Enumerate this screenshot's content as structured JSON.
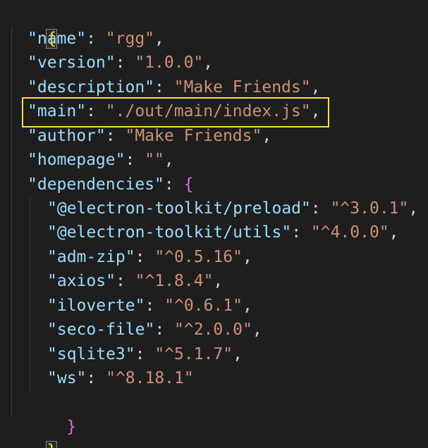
{
  "colors": {
    "background": "#1e1e1e",
    "key": "#9cdcfe",
    "string": "#ce9178",
    "punctuation": "#d4d4d4",
    "outer_brace": "#ffd700",
    "inner_brace": "#da70d6",
    "highlight_box": "#f5e13c"
  },
  "code": {
    "open_brace": "{",
    "close_brace": "}",
    "entries": [
      {
        "key": "\"name\"",
        "value": "\"rgg\"",
        "sep": ": ",
        "trail": ","
      },
      {
        "key": "\"version\"",
        "value": "\"1.0.0\"",
        "sep": ": ",
        "trail": ","
      },
      {
        "key": "\"description\"",
        "value": "\"Make Friends\"",
        "sep": ": ",
        "trail": ","
      },
      {
        "key": "\"main\"",
        "value": "\"./out/main/index.js\"",
        "sep": ": ",
        "trail": ","
      },
      {
        "key": "\"author\"",
        "value": "\"Make Friends\"",
        "sep": ": ",
        "trail": ","
      },
      {
        "key": "\"homepage\"",
        "value": "\"\"",
        "sep": ": ",
        "trail": ","
      }
    ],
    "dependencies": {
      "key": "\"dependencies\"",
      "sep": ": ",
      "open": "{",
      "close": "}",
      "items": [
        {
          "key": "\"@electron-toolkit/preload\"",
          "value": "\"^3.0.1\"",
          "sep": ": ",
          "trail": ","
        },
        {
          "key": "\"@electron-toolkit/utils\"",
          "value": "\"^4.0.0\"",
          "sep": ": ",
          "trail": ","
        },
        {
          "key": "\"adm-zip\"",
          "value": "\"^0.5.16\"",
          "sep": ": ",
          "trail": ","
        },
        {
          "key": "\"axios\"",
          "value": "\"^1.8.4\"",
          "sep": ": ",
          "trail": ","
        },
        {
          "key": "\"iloverte\"",
          "value": "\"^0.6.1\"",
          "sep": ": ",
          "trail": ","
        },
        {
          "key": "\"seco-file\"",
          "value": "\"^2.0.0\"",
          "sep": ": ",
          "trail": ","
        },
        {
          "key": "\"sqlite3\"",
          "value": "\"^5.1.7\"",
          "sep": ": ",
          "trail": ","
        },
        {
          "key": "\"ws\"",
          "value": "\"^8.18.1\"",
          "sep": ": ",
          "trail": ""
        }
      ]
    }
  }
}
